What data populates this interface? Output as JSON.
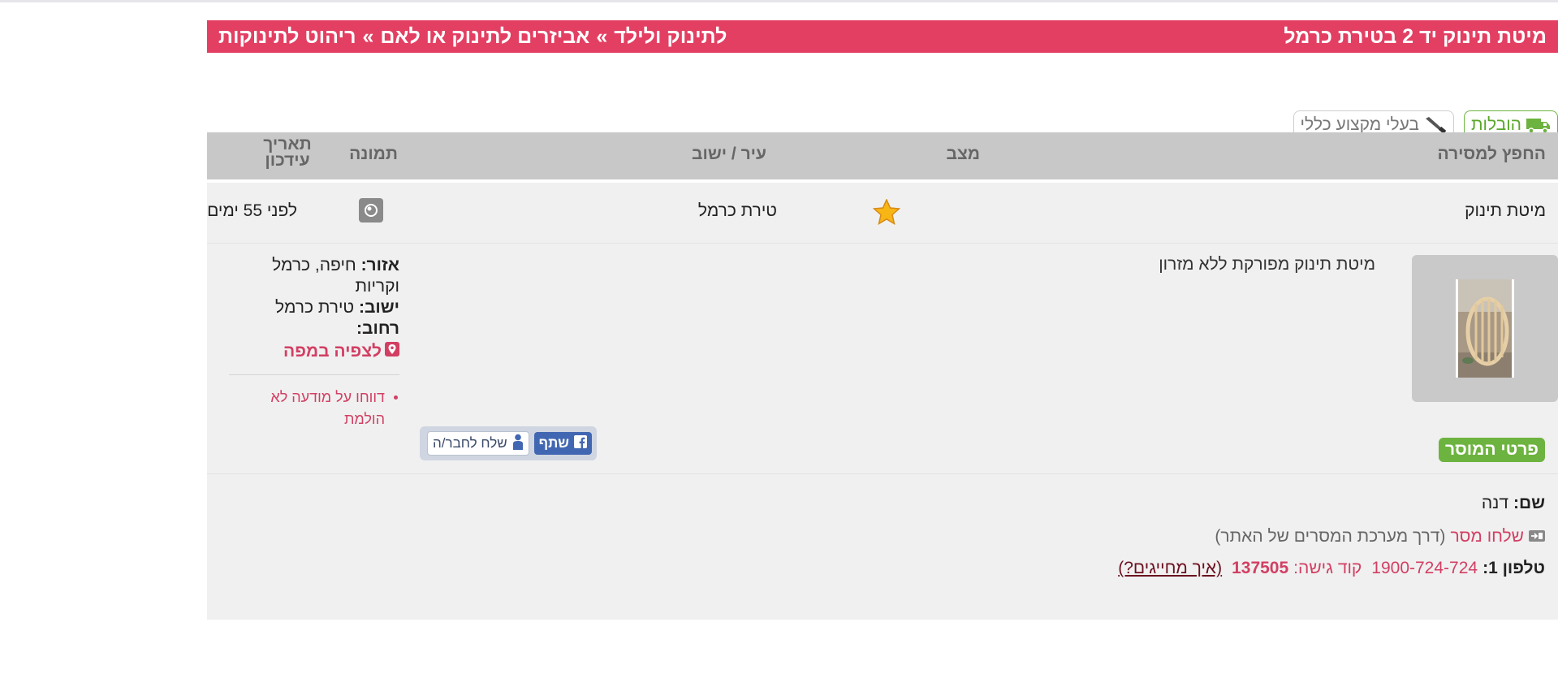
{
  "header": {
    "title": "מיטת תינוק יד 2 בטירת כרמל",
    "breadcrumb": [
      "לתינוק ולילד",
      "»",
      "אביזרים לתינוק או לאם",
      "»",
      "ריהוט לתינוקות"
    ]
  },
  "categories": {
    "deliveries": "הובלות",
    "pros": "בעלי מקצוע כללי"
  },
  "table": {
    "headers": {
      "item": "החפץ למסירה",
      "condition": "מצב",
      "city": "עיר / ישוב",
      "photo": "תמונה",
      "date": "תאריך עידכון"
    },
    "row": {
      "item": "מיטת תינוק",
      "city": "טירת כרמל",
      "date": "לפני 55 ימים"
    }
  },
  "details": {
    "description": "מיטת תינוק מפורקת ללא מזרון",
    "area_label": "אזור:",
    "area_value": "חיפה, כרמל וקריות",
    "city_label": "ישוב:",
    "city_value": "טירת כרמל",
    "street_label": "רחוב:",
    "map_link": "לצפיה במפה",
    "report_link": "דווחו על מודעה לא הולמת",
    "seller_button": "פרטי המוסר",
    "share_label": "שתף",
    "send_friend_label": "שלח לחבר/ה"
  },
  "seller": {
    "name_label": "שם:",
    "name_value": "דנה",
    "message_link": "שלחו מסר",
    "message_note": "(דרך מערכת המסרים של האתר)",
    "phone_label": "טלפון 1:",
    "phone_value": "1900-724-724",
    "access_label": "קוד גישה:",
    "access_code": "137505",
    "charge_link": "(איך מחייגים?)"
  },
  "colors": {
    "brand": "#e33f62",
    "green": "#6db33f",
    "facebook": "#4267b2"
  }
}
